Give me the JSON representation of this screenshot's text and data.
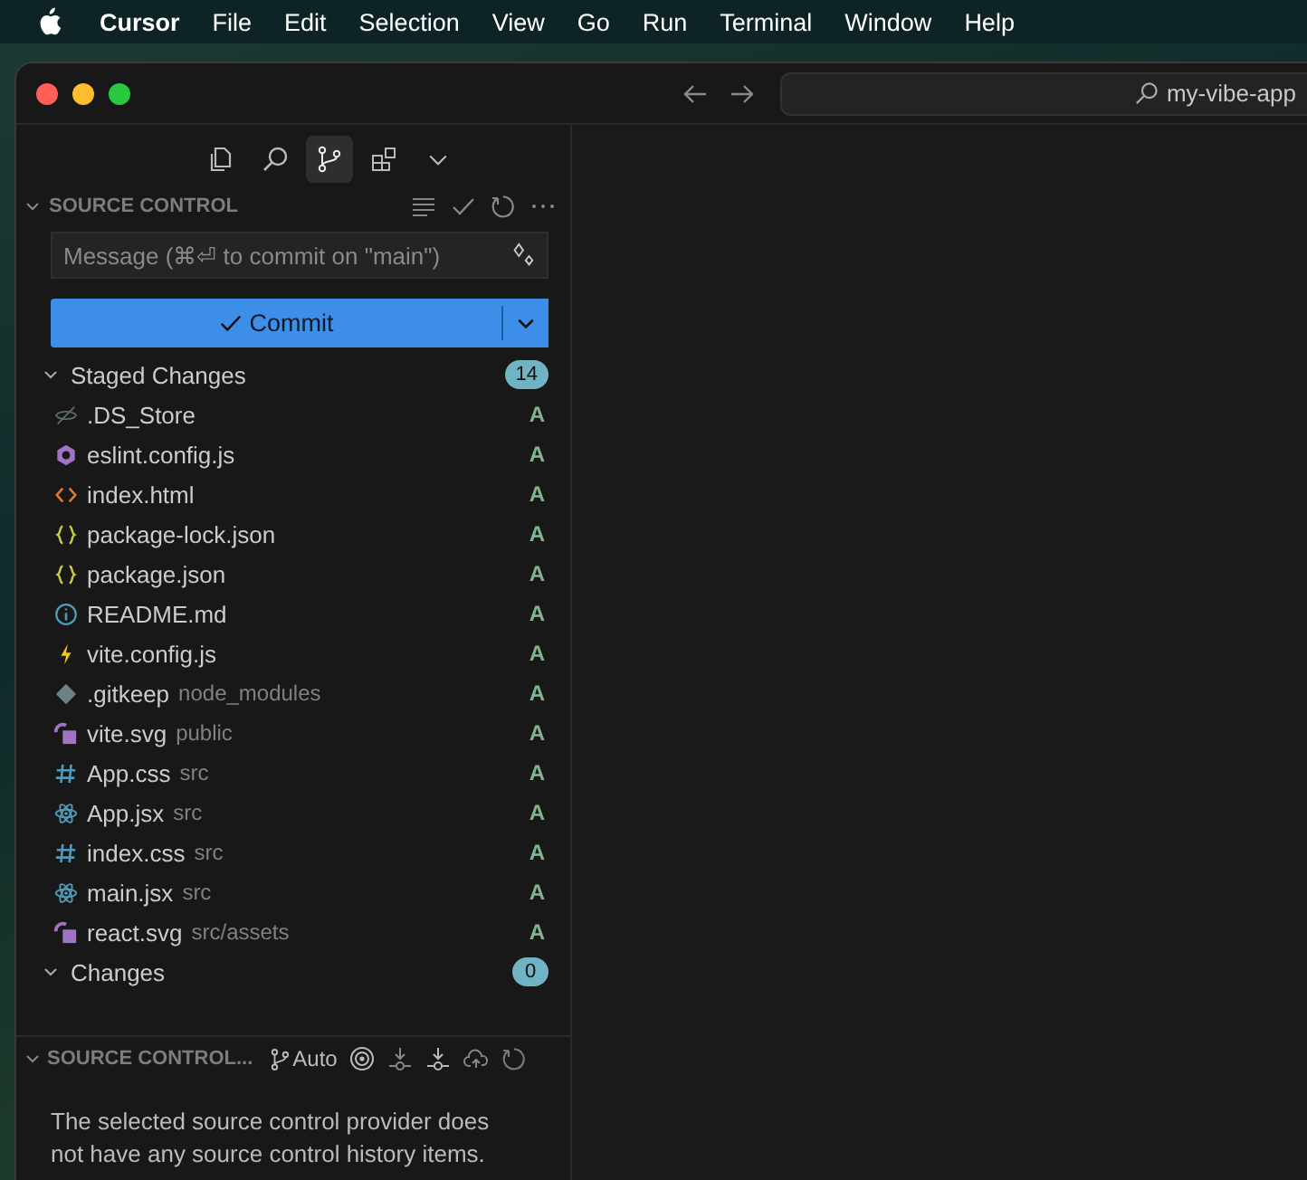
{
  "menu_bar": {
    "items": [
      {
        "label": "Cursor",
        "bold": true
      },
      {
        "label": "File",
        "bold": false
      },
      {
        "label": "Edit",
        "bold": false
      },
      {
        "label": "Selection",
        "bold": false
      },
      {
        "label": "View",
        "bold": false
      },
      {
        "label": "Go",
        "bold": false
      },
      {
        "label": "Run",
        "bold": false
      },
      {
        "label": "Terminal",
        "bold": false
      },
      {
        "label": "Window",
        "bold": false
      },
      {
        "label": "Help",
        "bold": false
      }
    ]
  },
  "title_bar": {
    "search": "my-vibe-app"
  },
  "activity_bar": [
    {
      "kind": "explorer",
      "selected": false
    },
    {
      "kind": "search",
      "selected": false
    },
    {
      "kind": "source-control",
      "selected": true
    },
    {
      "kind": "extensions",
      "selected": false
    },
    {
      "kind": "more",
      "selected": false
    }
  ],
  "source_control": {
    "title": "SOURCE CONTROL",
    "expanded": true,
    "message_placeholder": "Message (⌘⏎ to commit on \"main\")",
    "commit_button": "Commit",
    "groups": [
      {
        "label": "Staged Changes",
        "count": "14",
        "expanded": true,
        "files": [
          {
            "name": ".DS_Store",
            "kind": "hidden",
            "status": "A"
          },
          {
            "name": "eslint.config.js",
            "kind": "eslint",
            "status": "A"
          },
          {
            "name": "index.html",
            "kind": "html",
            "status": "A"
          },
          {
            "name": "package-lock.json",
            "kind": "json",
            "status": "A"
          },
          {
            "name": "package.json",
            "kind": "json",
            "status": "A"
          },
          {
            "name": "README.md",
            "kind": "info",
            "status": "A"
          },
          {
            "name": "vite.config.js",
            "kind": "bolt",
            "status": "A"
          },
          {
            "name": ".gitkeep",
            "folder": "node_modules",
            "kind": "git",
            "status": "A"
          },
          {
            "name": "vite.svg",
            "folder": "public",
            "kind": "svg",
            "status": "A"
          },
          {
            "name": "App.css",
            "folder": "src",
            "kind": "css",
            "status": "A"
          },
          {
            "name": "App.jsx",
            "folder": "src",
            "kind": "react",
            "status": "A"
          },
          {
            "name": "index.css",
            "folder": "src",
            "kind": "css",
            "status": "A"
          },
          {
            "name": "main.jsx",
            "folder": "src",
            "kind": "react",
            "status": "A"
          },
          {
            "name": "react.svg",
            "folder": "src/assets",
            "kind": "svg",
            "status": "A"
          }
        ]
      },
      {
        "label": "Changes",
        "count": "0",
        "expanded": true
      }
    ]
  },
  "graph": {
    "title": "SOURCE CONTROL...",
    "expanded": true,
    "branch_mode": "Auto",
    "empty_message": "The selected source control provider does not have any source control history items."
  }
}
